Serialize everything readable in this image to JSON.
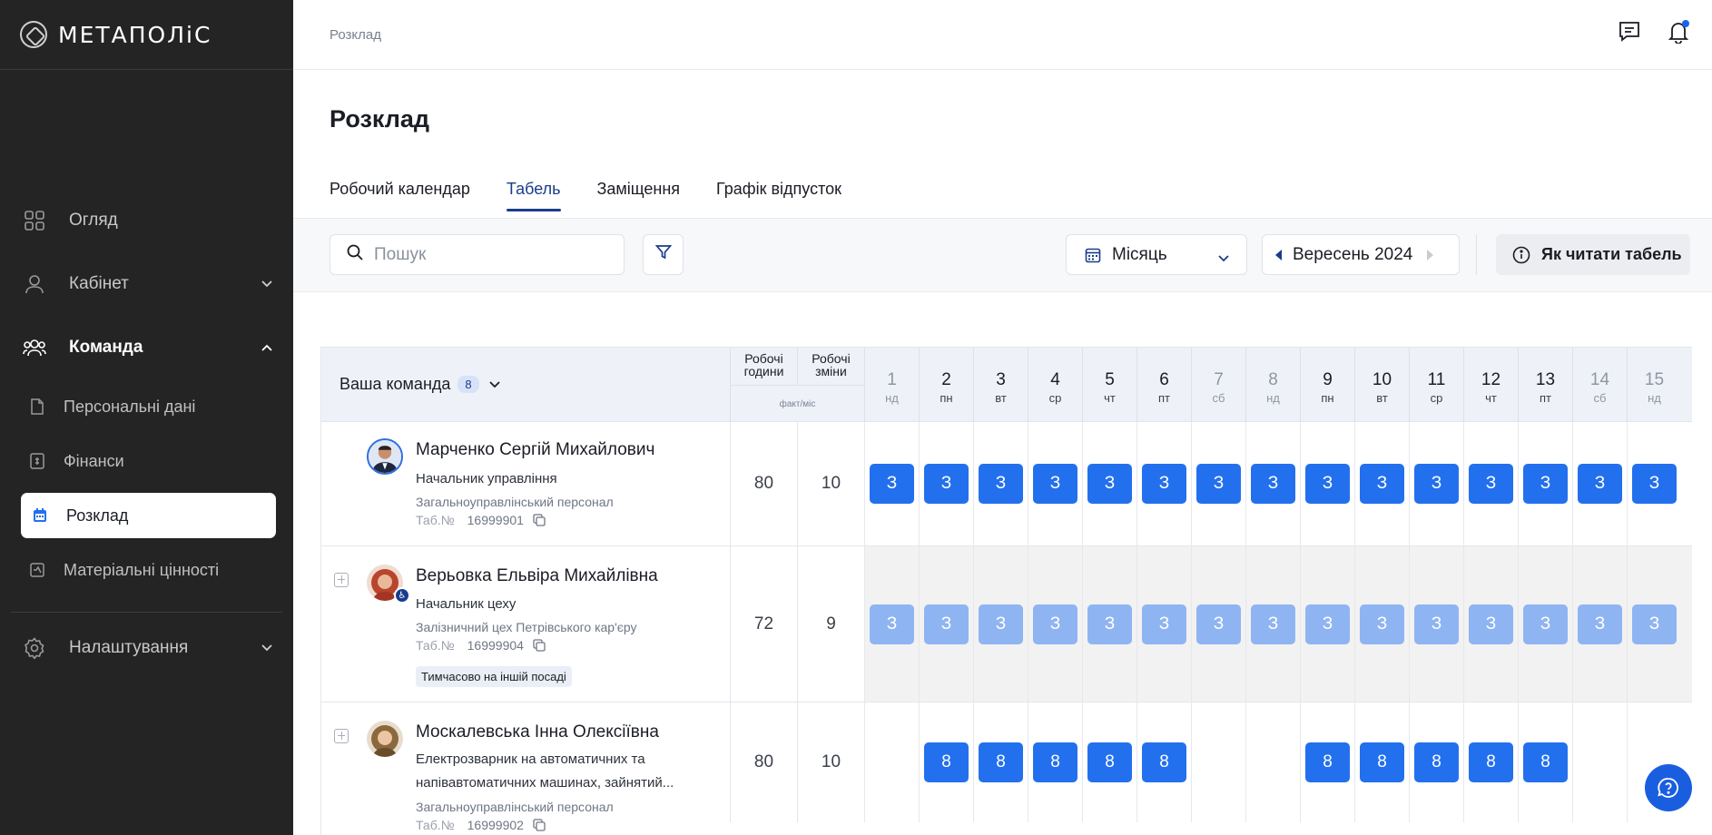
{
  "app": {
    "logo_text": "МЕТАПОЛіС"
  },
  "sidebar": {
    "items": [
      {
        "label": "Огляд",
        "icon": "grid-icon"
      },
      {
        "label": "Кабінет",
        "icon": "user-icon"
      },
      {
        "label": "Команда",
        "icon": "team-icon"
      }
    ],
    "team_sub": [
      {
        "label": "Персональні дані",
        "icon": "document-icon"
      },
      {
        "label": "Фінанси",
        "icon": "finance-icon"
      },
      {
        "label": "Розклад",
        "icon": "calendar-icon"
      },
      {
        "label": "Матеріальні цінності",
        "icon": "asset-icon"
      }
    ],
    "settings_label": "Налаштування"
  },
  "topbar": {
    "breadcrumb": "Розклад"
  },
  "page": {
    "title": "Розклад",
    "tabs": [
      "Робочий календар",
      "Табель",
      "Заміщення",
      "Графік відпусток"
    ],
    "active_tab": "Табель"
  },
  "toolbar": {
    "search_placeholder": "Пошук",
    "period": "Місяць",
    "month": "Вересень 2024",
    "help_label": "Як читати табель"
  },
  "table": {
    "team_label": "Ваша команда",
    "team_count": "8",
    "col_hours": [
      "Робочі",
      "години"
    ],
    "col_shifts": [
      "Робочі",
      "зміни"
    ],
    "col_sub": "факт/міс",
    "days": [
      {
        "n": "1",
        "w": "нд",
        "weekend": true
      },
      {
        "n": "2",
        "w": "пн",
        "weekend": false
      },
      {
        "n": "3",
        "w": "вт",
        "weekend": false
      },
      {
        "n": "4",
        "w": "ср",
        "weekend": false
      },
      {
        "n": "5",
        "w": "чт",
        "weekend": false
      },
      {
        "n": "6",
        "w": "пт",
        "weekend": false
      },
      {
        "n": "7",
        "w": "сб",
        "weekend": true
      },
      {
        "n": "8",
        "w": "нд",
        "weekend": true
      },
      {
        "n": "9",
        "w": "пн",
        "weekend": false
      },
      {
        "n": "10",
        "w": "вт",
        "weekend": false
      },
      {
        "n": "11",
        "w": "ср",
        "weekend": false
      },
      {
        "n": "12",
        "w": "чт",
        "weekend": false
      },
      {
        "n": "13",
        "w": "пт",
        "weekend": false
      },
      {
        "n": "14",
        "w": "сб",
        "weekend": true
      },
      {
        "n": "15",
        "w": "нд",
        "weekend": true
      }
    ],
    "employees": [
      {
        "name": "Марченко Сергій Михайлович",
        "position": "Начальник управління",
        "department": "Загальноуправлінський персонал",
        "tab_label": "Таб.№",
        "tab_number": "16999901",
        "hours": "80",
        "shifts": "10",
        "cells": [
          "З",
          "З",
          "З",
          "З",
          "З",
          "З",
          "З",
          "З",
          "З",
          "З",
          "З",
          "З",
          "З",
          "З",
          "З"
        ]
      },
      {
        "name": "Верьовка Ельвіра Михайлівна",
        "position": "Начальник цеху",
        "department": "Залізничний цех Петрівського кар'єру",
        "tab_label": "Таб.№",
        "tab_number": "16999904",
        "hours": "72",
        "shifts": "9",
        "status": "Тимчасово на іншій посаді",
        "cells": [
          "З",
          "З",
          "З",
          "З",
          "З",
          "З",
          "З",
          "З",
          "З",
          "З",
          "З",
          "З",
          "З",
          "З",
          "З"
        ]
      },
      {
        "name": "Москалевська Інна Олексіївна",
        "position": "Електрозварник на автоматичних та напівавтоматичних машинах, зайнятий...",
        "department": "Загальноуправлінський персонал",
        "tab_label": "Таб.№",
        "tab_number": "16999902",
        "hours": "80",
        "shifts": "10",
        "cells": [
          "",
          "8",
          "8",
          "8",
          "8",
          "8",
          "",
          "",
          "8",
          "8",
          "8",
          "8",
          "8",
          "",
          ""
        ]
      }
    ]
  },
  "colors": {
    "sidebar_bg": "#242424",
    "accent": "#1a3c8c",
    "chip": "#2370ee",
    "chip_light": "#8fb4f2"
  }
}
